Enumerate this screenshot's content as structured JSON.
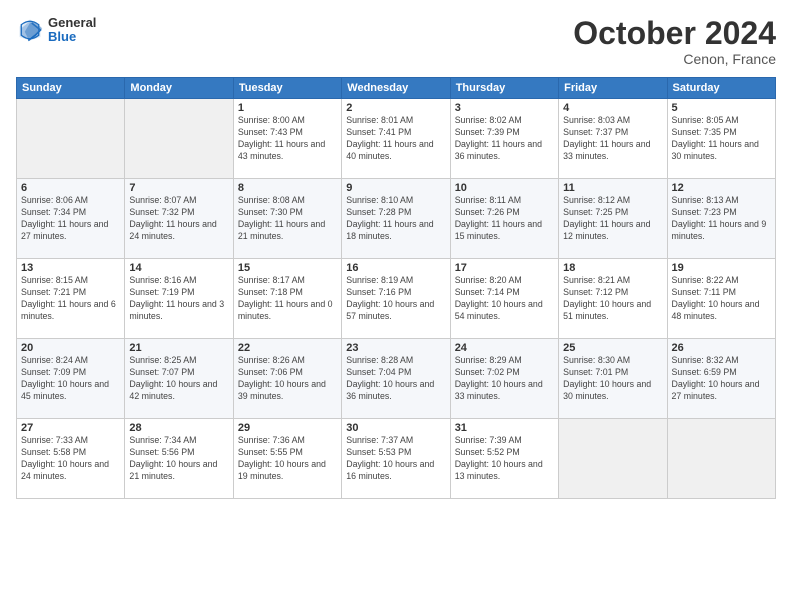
{
  "header": {
    "logo": {
      "general": "General",
      "blue": "Blue"
    },
    "title": "October 2024",
    "location": "Cenon, France"
  },
  "weekdays": [
    "Sunday",
    "Monday",
    "Tuesday",
    "Wednesday",
    "Thursday",
    "Friday",
    "Saturday"
  ],
  "weeks": [
    [
      {
        "day": "",
        "sunrise": "",
        "sunset": "",
        "daylight": ""
      },
      {
        "day": "",
        "sunrise": "",
        "sunset": "",
        "daylight": ""
      },
      {
        "day": "1",
        "sunrise": "Sunrise: 8:00 AM",
        "sunset": "Sunset: 7:43 PM",
        "daylight": "Daylight: 11 hours and 43 minutes."
      },
      {
        "day": "2",
        "sunrise": "Sunrise: 8:01 AM",
        "sunset": "Sunset: 7:41 PM",
        "daylight": "Daylight: 11 hours and 40 minutes."
      },
      {
        "day": "3",
        "sunrise": "Sunrise: 8:02 AM",
        "sunset": "Sunset: 7:39 PM",
        "daylight": "Daylight: 11 hours and 36 minutes."
      },
      {
        "day": "4",
        "sunrise": "Sunrise: 8:03 AM",
        "sunset": "Sunset: 7:37 PM",
        "daylight": "Daylight: 11 hours and 33 minutes."
      },
      {
        "day": "5",
        "sunrise": "Sunrise: 8:05 AM",
        "sunset": "Sunset: 7:35 PM",
        "daylight": "Daylight: 11 hours and 30 minutes."
      }
    ],
    [
      {
        "day": "6",
        "sunrise": "Sunrise: 8:06 AM",
        "sunset": "Sunset: 7:34 PM",
        "daylight": "Daylight: 11 hours and 27 minutes."
      },
      {
        "day": "7",
        "sunrise": "Sunrise: 8:07 AM",
        "sunset": "Sunset: 7:32 PM",
        "daylight": "Daylight: 11 hours and 24 minutes."
      },
      {
        "day": "8",
        "sunrise": "Sunrise: 8:08 AM",
        "sunset": "Sunset: 7:30 PM",
        "daylight": "Daylight: 11 hours and 21 minutes."
      },
      {
        "day": "9",
        "sunrise": "Sunrise: 8:10 AM",
        "sunset": "Sunset: 7:28 PM",
        "daylight": "Daylight: 11 hours and 18 minutes."
      },
      {
        "day": "10",
        "sunrise": "Sunrise: 8:11 AM",
        "sunset": "Sunset: 7:26 PM",
        "daylight": "Daylight: 11 hours and 15 minutes."
      },
      {
        "day": "11",
        "sunrise": "Sunrise: 8:12 AM",
        "sunset": "Sunset: 7:25 PM",
        "daylight": "Daylight: 11 hours and 12 minutes."
      },
      {
        "day": "12",
        "sunrise": "Sunrise: 8:13 AM",
        "sunset": "Sunset: 7:23 PM",
        "daylight": "Daylight: 11 hours and 9 minutes."
      }
    ],
    [
      {
        "day": "13",
        "sunrise": "Sunrise: 8:15 AM",
        "sunset": "Sunset: 7:21 PM",
        "daylight": "Daylight: 11 hours and 6 minutes."
      },
      {
        "day": "14",
        "sunrise": "Sunrise: 8:16 AM",
        "sunset": "Sunset: 7:19 PM",
        "daylight": "Daylight: 11 hours and 3 minutes."
      },
      {
        "day": "15",
        "sunrise": "Sunrise: 8:17 AM",
        "sunset": "Sunset: 7:18 PM",
        "daylight": "Daylight: 11 hours and 0 minutes."
      },
      {
        "day": "16",
        "sunrise": "Sunrise: 8:19 AM",
        "sunset": "Sunset: 7:16 PM",
        "daylight": "Daylight: 10 hours and 57 minutes."
      },
      {
        "day": "17",
        "sunrise": "Sunrise: 8:20 AM",
        "sunset": "Sunset: 7:14 PM",
        "daylight": "Daylight: 10 hours and 54 minutes."
      },
      {
        "day": "18",
        "sunrise": "Sunrise: 8:21 AM",
        "sunset": "Sunset: 7:12 PM",
        "daylight": "Daylight: 10 hours and 51 minutes."
      },
      {
        "day": "19",
        "sunrise": "Sunrise: 8:22 AM",
        "sunset": "Sunset: 7:11 PM",
        "daylight": "Daylight: 10 hours and 48 minutes."
      }
    ],
    [
      {
        "day": "20",
        "sunrise": "Sunrise: 8:24 AM",
        "sunset": "Sunset: 7:09 PM",
        "daylight": "Daylight: 10 hours and 45 minutes."
      },
      {
        "day": "21",
        "sunrise": "Sunrise: 8:25 AM",
        "sunset": "Sunset: 7:07 PM",
        "daylight": "Daylight: 10 hours and 42 minutes."
      },
      {
        "day": "22",
        "sunrise": "Sunrise: 8:26 AM",
        "sunset": "Sunset: 7:06 PM",
        "daylight": "Daylight: 10 hours and 39 minutes."
      },
      {
        "day": "23",
        "sunrise": "Sunrise: 8:28 AM",
        "sunset": "Sunset: 7:04 PM",
        "daylight": "Daylight: 10 hours and 36 minutes."
      },
      {
        "day": "24",
        "sunrise": "Sunrise: 8:29 AM",
        "sunset": "Sunset: 7:02 PM",
        "daylight": "Daylight: 10 hours and 33 minutes."
      },
      {
        "day": "25",
        "sunrise": "Sunrise: 8:30 AM",
        "sunset": "Sunset: 7:01 PM",
        "daylight": "Daylight: 10 hours and 30 minutes."
      },
      {
        "day": "26",
        "sunrise": "Sunrise: 8:32 AM",
        "sunset": "Sunset: 6:59 PM",
        "daylight": "Daylight: 10 hours and 27 minutes."
      }
    ],
    [
      {
        "day": "27",
        "sunrise": "Sunrise: 7:33 AM",
        "sunset": "Sunset: 5:58 PM",
        "daylight": "Daylight: 10 hours and 24 minutes."
      },
      {
        "day": "28",
        "sunrise": "Sunrise: 7:34 AM",
        "sunset": "Sunset: 5:56 PM",
        "daylight": "Daylight: 10 hours and 21 minutes."
      },
      {
        "day": "29",
        "sunrise": "Sunrise: 7:36 AM",
        "sunset": "Sunset: 5:55 PM",
        "daylight": "Daylight: 10 hours and 19 minutes."
      },
      {
        "day": "30",
        "sunrise": "Sunrise: 7:37 AM",
        "sunset": "Sunset: 5:53 PM",
        "daylight": "Daylight: 10 hours and 16 minutes."
      },
      {
        "day": "31",
        "sunrise": "Sunrise: 7:39 AM",
        "sunset": "Sunset: 5:52 PM",
        "daylight": "Daylight: 10 hours and 13 minutes."
      },
      {
        "day": "",
        "sunrise": "",
        "sunset": "",
        "daylight": ""
      },
      {
        "day": "",
        "sunrise": "",
        "sunset": "",
        "daylight": ""
      }
    ]
  ]
}
